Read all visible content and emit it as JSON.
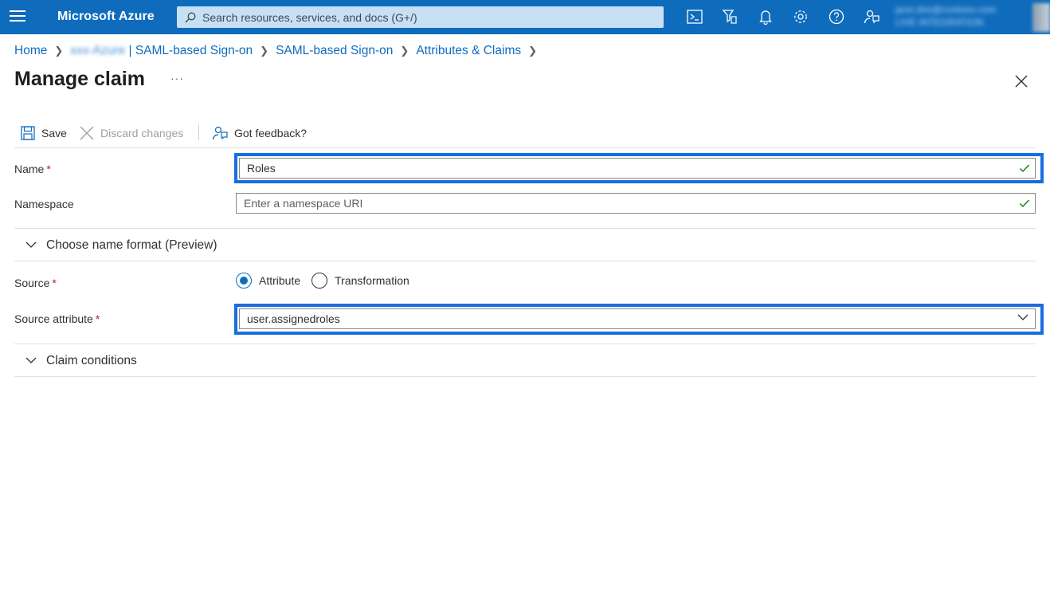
{
  "topbar": {
    "brand": "Microsoft Azure",
    "search_placeholder": "Search resources, services, and docs (G+/)",
    "icons": [
      "cloud-shell-icon",
      "directory-filter-icon",
      "notifications-icon",
      "settings-icon",
      "help-icon",
      "feedback-icon"
    ],
    "account_line1": "jane.doe@contoso.com",
    "account_line2": "LIVE INTEGRATION"
  },
  "breadcrumb": {
    "home": "Home",
    "app_name_blurred": "xxx-Azure",
    "app_suffix": "| SAML-based Sign-on",
    "saml": "SAML-based Sign-on",
    "attributes": "Attributes & Claims"
  },
  "page": {
    "title": "Manage claim",
    "more": "···"
  },
  "toolbar": {
    "save_label": "Save",
    "discard_label": "Discard changes",
    "feedback_label": "Got feedback?"
  },
  "form": {
    "name_label": "Name",
    "name_value": "Roles",
    "namespace_label": "Namespace",
    "namespace_placeholder": "Enter a namespace URI",
    "name_format_section": "Choose name format (Preview)",
    "source_label": "Source",
    "source_options": [
      "Attribute",
      "Transformation"
    ],
    "source_selected": "Attribute",
    "source_attribute_label": "Source attribute",
    "source_attribute_value": "user.assignedroles",
    "claim_conditions_section": "Claim conditions",
    "required_marker": "*"
  },
  "colors": {
    "brand_blue": "#0f6cbd",
    "highlight_blue": "#1a6de0",
    "required_red": "#a4262c",
    "check_green": "#107c10"
  }
}
